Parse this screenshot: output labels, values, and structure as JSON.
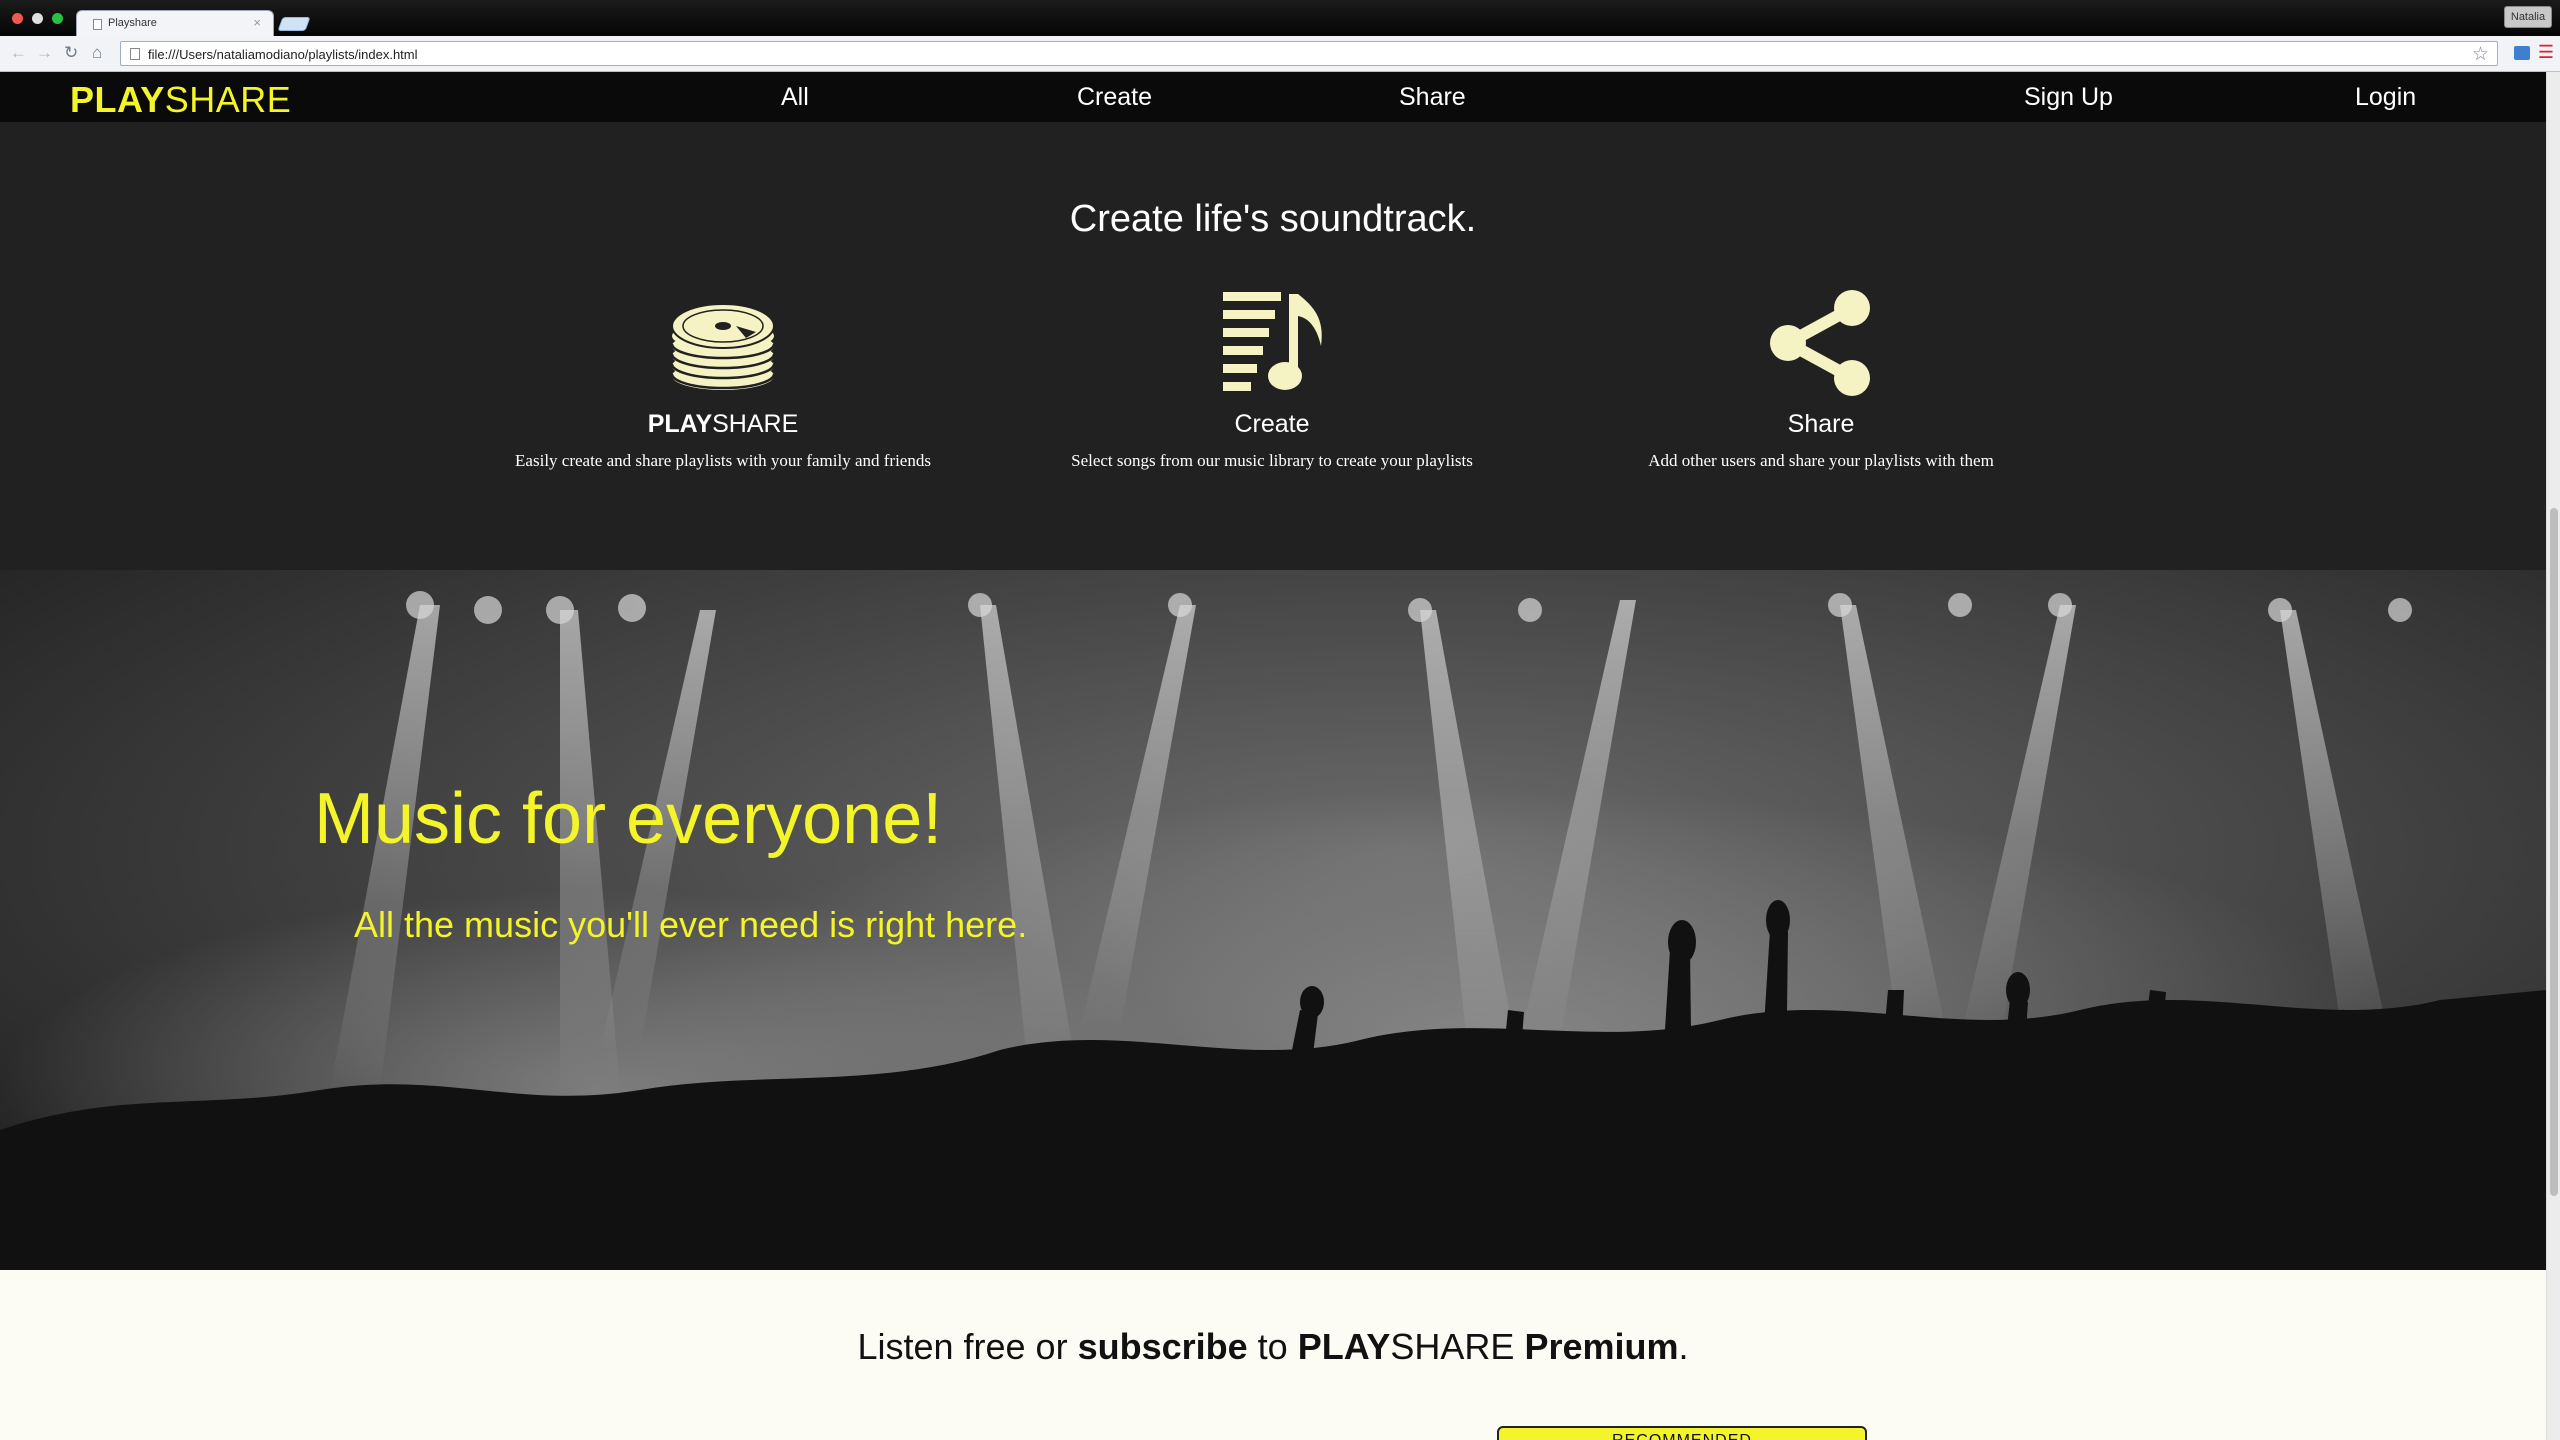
{
  "browser": {
    "tab_title": "Playshare",
    "tab_close": "×",
    "url": "file:///Users/nataliamodiano/playlists/index.html",
    "profile_name": "Natalia"
  },
  "nav": {
    "logo_bold": "PLAY",
    "logo_light": "SHARE",
    "links": [
      "All",
      "Create",
      "Share"
    ],
    "signup": "Sign Up",
    "login": "Login"
  },
  "features": {
    "tagline": "Create life's soundtrack.",
    "items": [
      {
        "title_bold": "PLAY",
        "title_light": "SHARE",
        "desc": "Easily create and share playlists with your family and friends",
        "icon": "disc-stack-icon"
      },
      {
        "title": "Create",
        "desc": "Select songs from our music library to create your playlists",
        "icon": "music-list-icon"
      },
      {
        "title": "Share",
        "desc": "Add other users and share your playlists with them",
        "icon": "share-icon"
      }
    ]
  },
  "hero": {
    "title": "Music for everyone!",
    "subtitle": "All the music you'll ever need is right here."
  },
  "pricing": {
    "heading_parts": [
      "Listen free or ",
      "subscribe",
      " to ",
      "PLAY",
      "SHARE",
      " ",
      "Premium",
      "."
    ],
    "recommended_label": "RECOMMENDED"
  },
  "colors": {
    "brand_yellow": "#f4f42a",
    "nav_bg": "#0a0a0a",
    "features_bg": "#212121",
    "icon_cream": "#f5f2c4",
    "page_bg": "#fcfcf4"
  }
}
